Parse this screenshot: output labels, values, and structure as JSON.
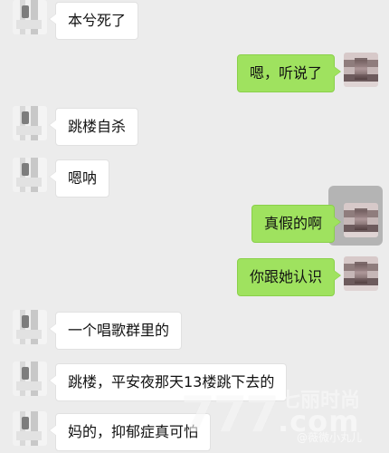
{
  "messages": [
    {
      "text": "本兮死了",
      "side": "left"
    },
    {
      "text": "嗯，听说了",
      "side": "right"
    },
    {
      "text": "跳楼自杀",
      "side": "left"
    },
    {
      "text": "嗯呐",
      "side": "left"
    },
    {
      "text": "真假的啊",
      "side": "right"
    },
    {
      "text": "你跟她认识",
      "side": "right"
    },
    {
      "text": "一个唱歌群里的",
      "side": "left"
    },
    {
      "text": "跳楼，平安夜那天13楼跳下去的",
      "side": "left"
    },
    {
      "text": "妈的，抑郁症真可怕",
      "side": "left"
    }
  ],
  "watermark": {
    "mark": "777",
    "title": "七丽时尚",
    "domain": ".com",
    "credit": "@薇微小丸儿"
  },
  "colors": {
    "background": "#ececec",
    "left_bubble": "#ffffff",
    "right_bubble": "#9fe25f"
  }
}
